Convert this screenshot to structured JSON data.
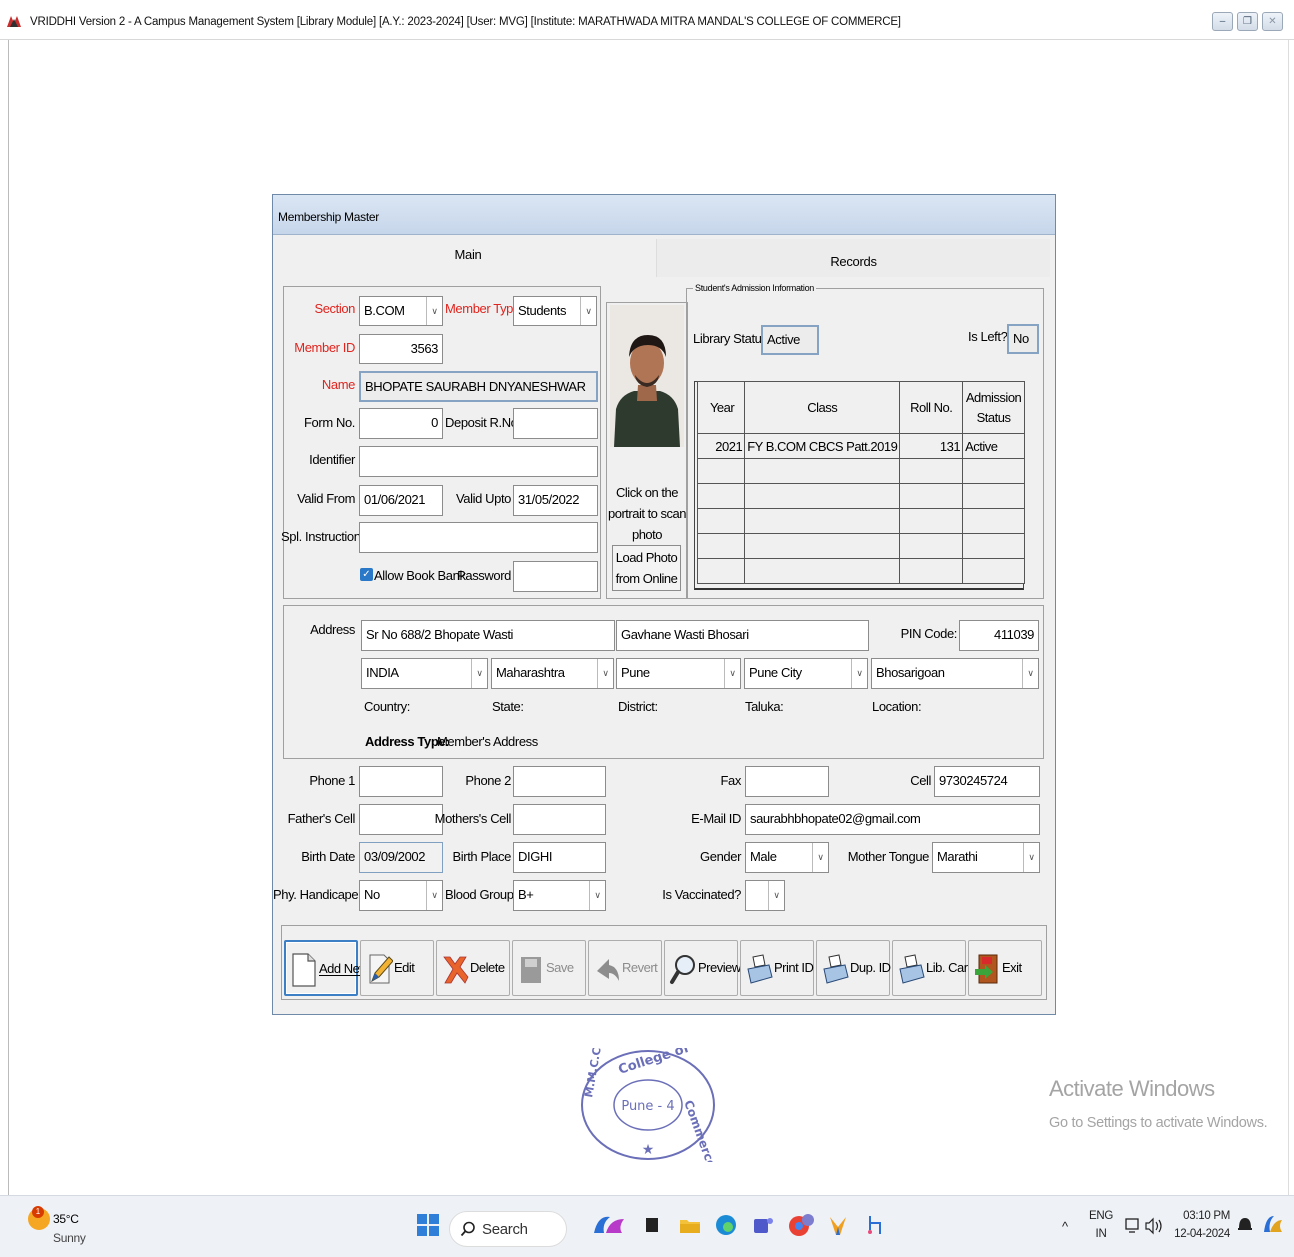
{
  "window": {
    "title": "VRIDDHI Version 2 - A Campus Management System [Library Module] [A.Y.: 2023-2024] [User: MVG] [Institute: MARATHWADA MITRA MANDAL'S COLLEGE OF COMMERCE]",
    "minimize": "–",
    "maximize": "❐",
    "close": "✕"
  },
  "dialog": {
    "title": "Membership Master",
    "tabs": [
      "Main",
      "Records"
    ]
  },
  "member": {
    "section_label": "Section",
    "section_value": "B.COM",
    "member_type_label": "Member Type",
    "member_type_value": "Students",
    "member_id_label": "Member ID",
    "member_id_value": "3563",
    "name_label": "Name",
    "name_value": "BHOPATE SAURABH DNYANESHWAR",
    "form_no_label": "Form No.",
    "form_no_value": "0",
    "deposit_label": "Deposit R.No.",
    "deposit_value": "",
    "identifier_label": "Identifier",
    "identifier_value": "",
    "valid_from_label": "Valid From",
    "valid_from_value": "01/06/2021",
    "valid_upto_label": "Valid Upto",
    "valid_upto_value": "31/05/2022",
    "spl_instruction_label": "Spl. Instruction",
    "spl_instruction_value": "",
    "allow_book_bank_label": "Allow Book Bank",
    "allow_book_bank_checked": "✓",
    "password_label": "Password",
    "password_value": ""
  },
  "photo": {
    "scan_text": "Click on the portrait to scan photo",
    "load_button": "Load Photo from Online"
  },
  "admission": {
    "caption": "Student's Admission Information",
    "library_status_label": "Library Status",
    "library_status_value": "Active",
    "is_left_label": "Is Left?",
    "is_left_value": "No",
    "headers": [
      "Year",
      "Class",
      "Roll No.",
      "Admission Status"
    ],
    "rows": [
      [
        "2021",
        "FY B.COM CBCS Patt.2019",
        "131",
        "Active"
      ]
    ]
  },
  "address": {
    "label": "Address",
    "line1": "Sr No 688/2 Bhopate Wasti",
    "line2": "Gavhane Wasti Bhosari",
    "pin_label": "PIN Code:",
    "pin_value": "411039",
    "country": "INDIA",
    "state": "Maharashtra",
    "district": "Pune",
    "taluka": "Pune City",
    "location": "Bhosarigoan",
    "country_label": "Country:",
    "state_label": "State:",
    "district_label": "District:",
    "taluka_label": "Taluka:",
    "location_label": "Location:",
    "type_label": "Address Type:",
    "type_value": "Member's Address"
  },
  "contact": {
    "phone1_label": "Phone 1",
    "phone1_value": "",
    "phone2_label": "Phone 2",
    "phone2_value": "",
    "fax_label": "Fax",
    "fax_value": "",
    "cell_label": "Cell",
    "cell_value": "9730245724",
    "father_cell_label": "Father's Cell",
    "father_cell_value": "",
    "mother_cell_label": "Mothers's Cell",
    "mother_cell_value": "",
    "email_label": "E-Mail ID",
    "email_value": "saurabhbhopate02@gmail.com",
    "birth_date_label": "Birth Date",
    "birth_date_value": "03/09/2002",
    "birth_place_label": "Birth Place",
    "birth_place_value": "DIGHI",
    "gender_label": "Gender",
    "gender_value": "Male",
    "mother_tongue_label": "Mother Tongue",
    "mother_tongue_value": "Marathi",
    "handicap_label": "Phy. Handicape",
    "handicap_value": "No",
    "blood_group_label": "Blood Group",
    "blood_group_value": "B+",
    "vaccinated_label": "Is Vaccinated?",
    "vaccinated_value": ""
  },
  "buttons": {
    "add_new": "Add New",
    "edit": "Edit",
    "delete": "Delete",
    "save": "Save",
    "revert": "Revert",
    "preview": "Preview",
    "print_id": "Print ID",
    "dup_id": "Dup. ID",
    "lib_card": "Lib. Card",
    "exit": "Exit"
  },
  "stamp": {
    "text": "College of Commerce",
    "center": "Pune - 4",
    "initials": "M.M.C.C."
  },
  "watermark": {
    "line1": "Activate Windows",
    "line2": "Go to Settings to activate Windows."
  },
  "taskbar": {
    "weather_temp": "35°C",
    "weather_cond": "Sunny",
    "weather_badge": "1",
    "search_label": "Search",
    "lang_top": "ENG",
    "lang_bottom": "IN",
    "time": "03:10 PM",
    "date": "12-04-2024",
    "chevron": "^"
  },
  "colors": {
    "required_label": "#e0241e",
    "title_gradient_top": "#dbe6f4",
    "focus_border": "#3c7fc4"
  }
}
